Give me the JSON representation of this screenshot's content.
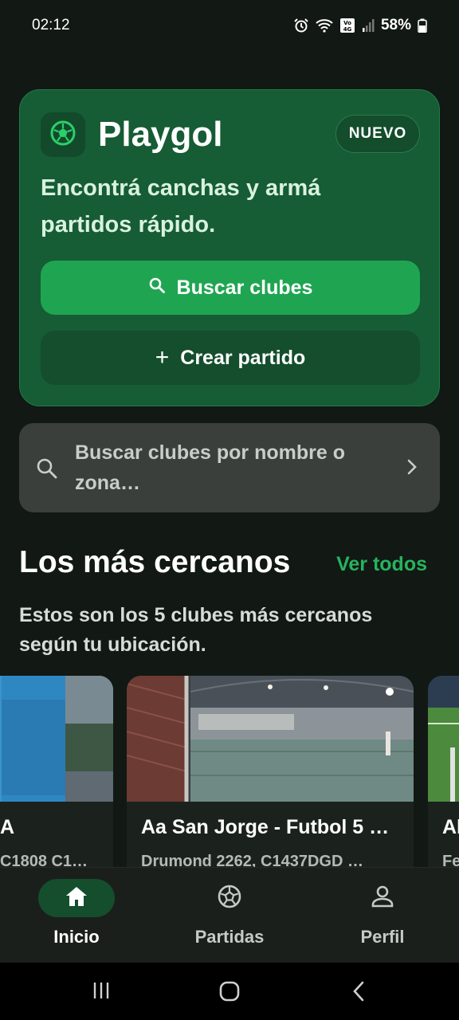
{
  "status_bar": {
    "time": "02:12",
    "battery": "58%"
  },
  "hero": {
    "brand": "Playgol",
    "badge": "NUEVO",
    "tagline": "Encontrá canchas y armá partidos rápido.",
    "primary_button": "Buscar clubes",
    "secondary_button": "Crear partido"
  },
  "search": {
    "placeholder": "Buscar clubes por nombre o zona…"
  },
  "nearby": {
    "title": "Los más cercanos",
    "see_all": "Ver todos",
    "subtitle": "Estos son los 5 clubes más cercanos según tu ubicación.",
    "clubs": [
      {
        "name": "A",
        "address": "C1808 C1…"
      },
      {
        "name": "Aa San Jorge - Futbol 5 …",
        "address": "Drumond 2262, C1437DGD …"
      },
      {
        "name": "Al",
        "address": "Fe"
      }
    ]
  },
  "bottom_nav": {
    "items": [
      {
        "label": "Inicio",
        "icon": "home-icon",
        "active": true
      },
      {
        "label": "Partidas",
        "icon": "soccer-ball-icon",
        "active": false
      },
      {
        "label": "Perfil",
        "icon": "person-icon",
        "active": false
      }
    ]
  },
  "colors": {
    "accent": "#1fa551",
    "hero_bg": "#165c34",
    "background": "#121814"
  }
}
